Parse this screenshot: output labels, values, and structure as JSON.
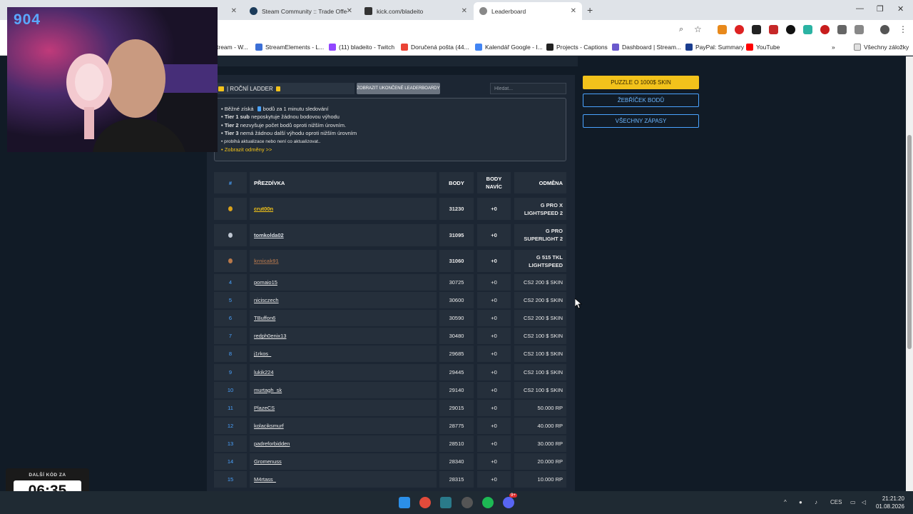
{
  "browser": {
    "tabs": [
      {
        "label": "",
        "active": false
      },
      {
        "label": "Steam Community :: Trade Offe",
        "active": false
      },
      {
        "label": "kick.com/bladeito",
        "active": false
      },
      {
        "label": "Leaderboard",
        "active": true
      }
    ],
    "new_tab_label": "+",
    "bookmarks": [
      "tream - W...",
      "StreamElements - L...",
      "(11) bladeito - Twitch",
      "Doručená pošta (44...",
      "Kalendář Google - I...",
      "Projects - Captions",
      "Dashboard | Stream...",
      "PayPal: Summary",
      "YouTube"
    ],
    "bookmarks_more": "»",
    "all_bookmarks": "Všechny záložky"
  },
  "leaderboard": {
    "ladder_tab": "| ROČNÍ LADDER",
    "show_ended_button": "ZOBRAZIT UKONČENÉ LEADERBOARDY",
    "search_placeholder": "Hledat...",
    "info": {
      "line1": "• Běžné získá",
      "line1_rest": "bodů za 1 minutu sledování",
      "line2_bold": "• Tier 1 sub",
      "line2_rest": "neposkytuje žádnou bodovou výhodu",
      "line3_bold": "• Tier 2",
      "line3_rest": "nezvyšuje počet bodů oproti nižším úrovním.",
      "line4_bold": "• Tier 3",
      "line4_rest": "nemá žádnou další výhodu oproti nižším úrovním",
      "line5": "• probíhá aktualizace nebo není co aktualizovat..",
      "line6": "• Zobrazit odměny >>"
    },
    "headers": {
      "rank": "#",
      "nick": "PŘEZDÍVKA",
      "points": "BODY",
      "bonus_line1": "BODY",
      "bonus_line2": "NAVÍC",
      "reward": "ODMĚNA"
    },
    "top_rows": [
      {
        "nick": "crut00n",
        "points": "31230",
        "bonus": "+0",
        "reward_l1": "G PRO X",
        "reward_l2": "LIGHTSPEED 2",
        "medal": "#d9a21b",
        "nick_color": "#f5c518"
      },
      {
        "nick": "tomkolda02",
        "points": "31095",
        "bonus": "+0",
        "reward_l1": "G PRO",
        "reward_l2": "SUPERLIGHT 2",
        "medal": "#bfc7d2",
        "nick_color": "#d8dde3"
      },
      {
        "nick": "krnicak91",
        "points": "31060",
        "bonus": "+0",
        "reward_l1": "G 515 TKL",
        "reward_l2": "LIGHTSPEED",
        "medal": "#b8784a",
        "nick_color": "#9a6a4a"
      }
    ],
    "rows": [
      {
        "rank": "4",
        "nick": "pomaio15",
        "points": "30725",
        "bonus": "+0",
        "reward": "CS2 200 $ SKIN"
      },
      {
        "rank": "5",
        "nick": "nicisczech",
        "points": "30600",
        "bonus": "+0",
        "reward": "CS2 200 $ SKIN"
      },
      {
        "rank": "6",
        "nick": "TBuffon6",
        "points": "30590",
        "bonus": "+0",
        "reward": "CS2 200 $ SKIN"
      },
      {
        "rank": "7",
        "nick": "redph0enix13",
        "points": "30480",
        "bonus": "+0",
        "reward": "CS2 100 $ SKIN"
      },
      {
        "rank": "8",
        "nick": "j1rkos_",
        "points": "29685",
        "bonus": "+0",
        "reward": "CS2 100 $ SKIN"
      },
      {
        "rank": "9",
        "nick": "lukik224",
        "points": "29445",
        "bonus": "+0",
        "reward": "CS2 100 $ SKIN"
      },
      {
        "rank": "10",
        "nick": "murtagh_sk",
        "points": "29140",
        "bonus": "+0",
        "reward": "CS2 100 $ SKIN"
      },
      {
        "rank": "11",
        "nick": "PlazeCS",
        "points": "29015",
        "bonus": "+0",
        "reward": "50.000 RP"
      },
      {
        "rank": "12",
        "nick": "kolaciksmurf",
        "points": "28775",
        "bonus": "+0",
        "reward": "40.000 RP"
      },
      {
        "rank": "13",
        "nick": "padreforbidden",
        "points": "28510",
        "bonus": "+0",
        "reward": "30.000 RP"
      },
      {
        "rank": "14",
        "nick": "Gromenuss",
        "points": "28340",
        "bonus": "+0",
        "reward": "20.000 RP"
      },
      {
        "rank": "15",
        "nick": "M4rtass_",
        "points": "28315",
        "bonus": "+0",
        "reward": "10.000 RP"
      }
    ]
  },
  "sidebar": {
    "puzzle_button": "PUZZLE O 1000$ SKIN",
    "points_ladder_button": "ŽEBŘÍČEK BODŮ",
    "all_matches_button": "VŠECHNY ZÁPASY"
  },
  "overlay": {
    "cam_number": "904",
    "countdown_label": "DALŠÍ KÓD ZA",
    "countdown_time": "06:35"
  },
  "taskbar": {
    "language": "CES",
    "time": "21:21:20",
    "date": "01.08.2026",
    "notification_badge": "9+"
  },
  "colors": {
    "accent_blue": "#4aa3ff",
    "gold": "#f2c21b",
    "page_bg": "#111b26",
    "cell_bg": "#252f3b"
  }
}
